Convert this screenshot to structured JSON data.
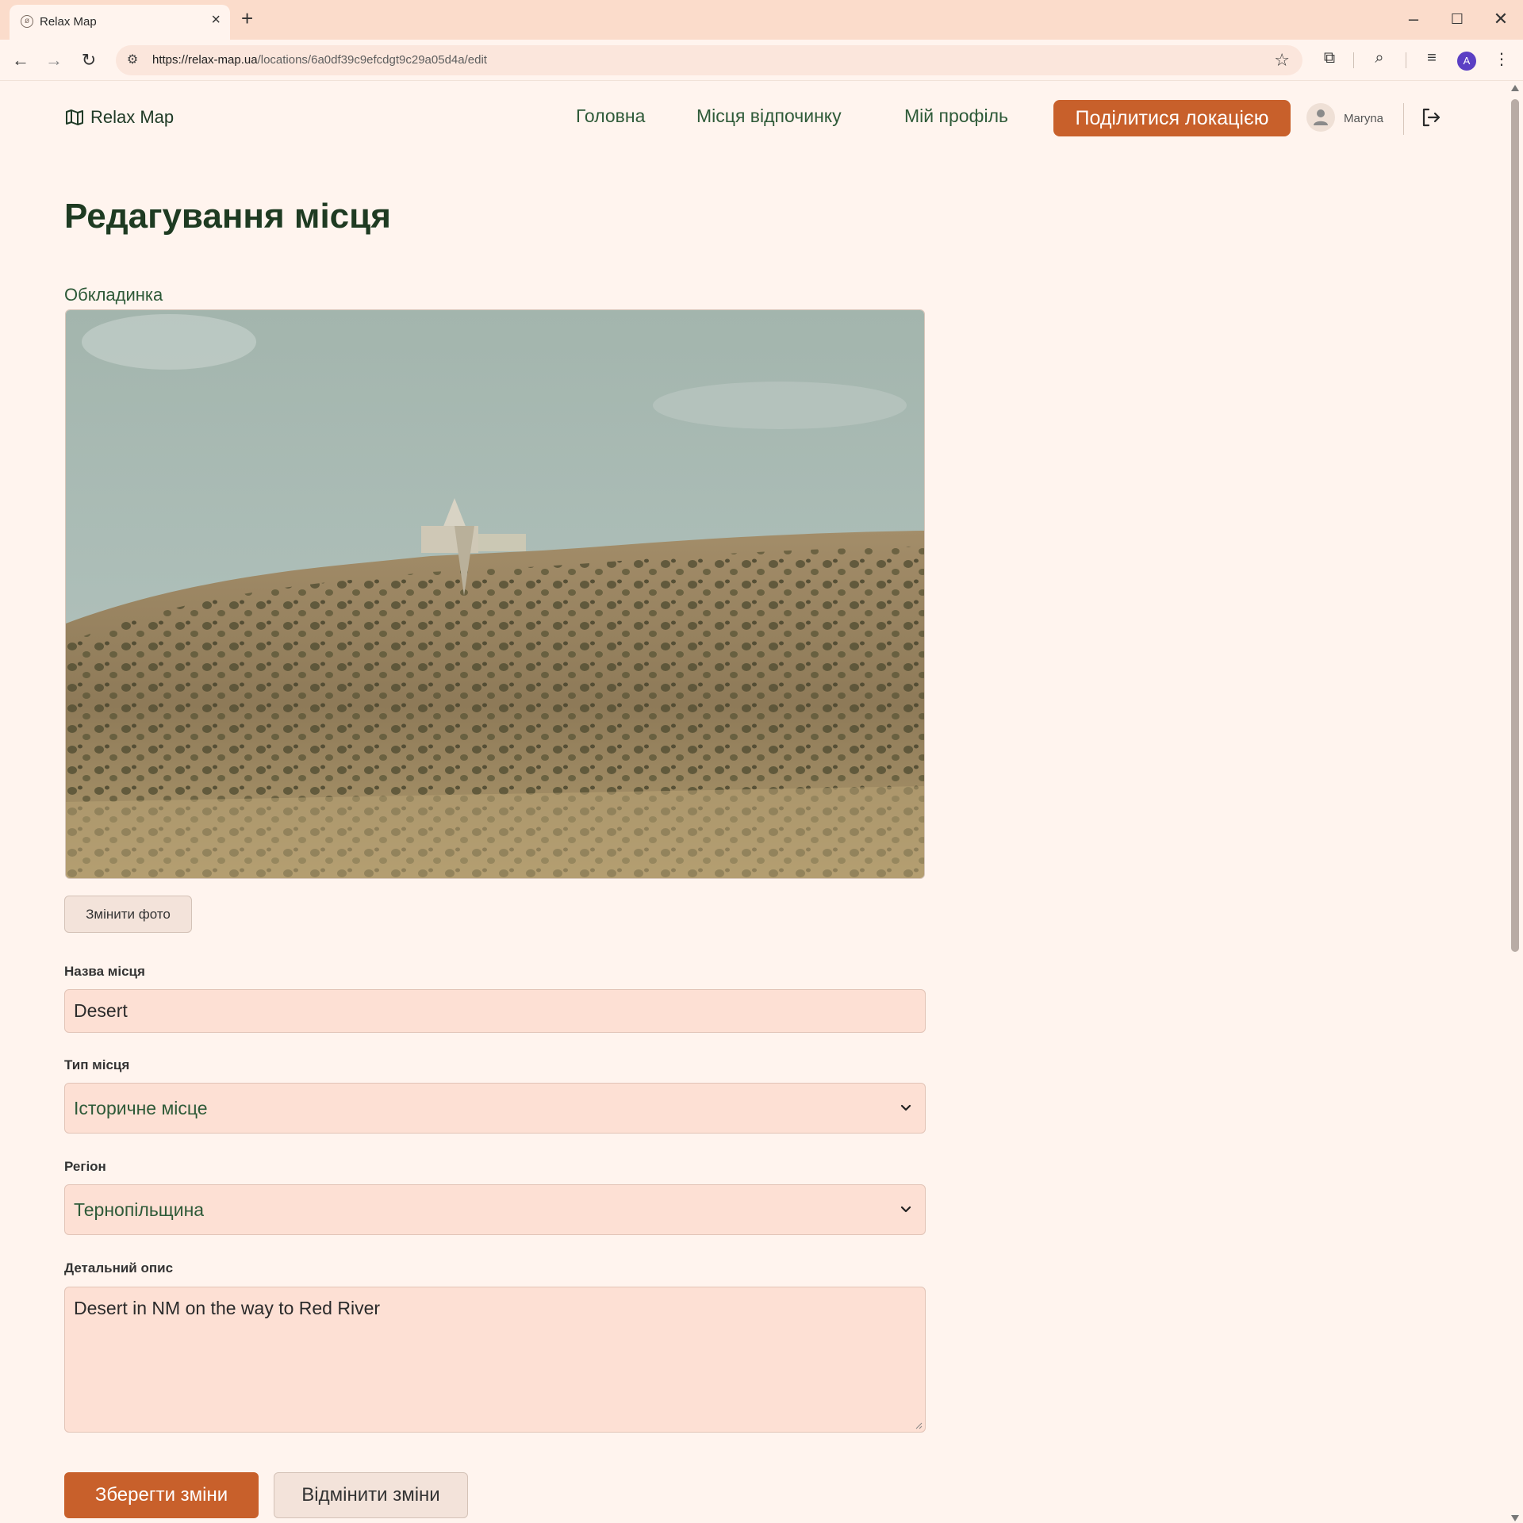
{
  "browser": {
    "tab_title": "Relax Map",
    "url_host": "https://relax-map.ua",
    "url_path": "/locations/6a0df39c9efcdgt9c29a05d4a/edit",
    "profile_initial": "A"
  },
  "header": {
    "logo_text": "Relax Map",
    "nav": {
      "home": "Головна",
      "places": "Місця відпочинку",
      "profile": "Мій профіль"
    },
    "share_button": "Поділитися локацією",
    "user_name": "Maryna"
  },
  "page": {
    "title": "Редагування місця",
    "cover_label": "Обкладинка",
    "change_photo_button": "Змінити фото"
  },
  "form": {
    "name_label": "Назва місця",
    "name_value": "Desert",
    "type_label": "Тип місця",
    "type_value": "Історичне місце",
    "region_label": "Регіон",
    "region_value": "Тернопільщина",
    "description_label": "Детальний опис",
    "description_value": "Desert in NM on the way to Red River",
    "save_button": "Зберегти зміни",
    "cancel_button": "Відмінити зміни"
  },
  "colors": {
    "accent": "#c8602b",
    "background": "#fff4ee",
    "field_bg": "#fde0d4",
    "heading": "#1e3b22"
  }
}
